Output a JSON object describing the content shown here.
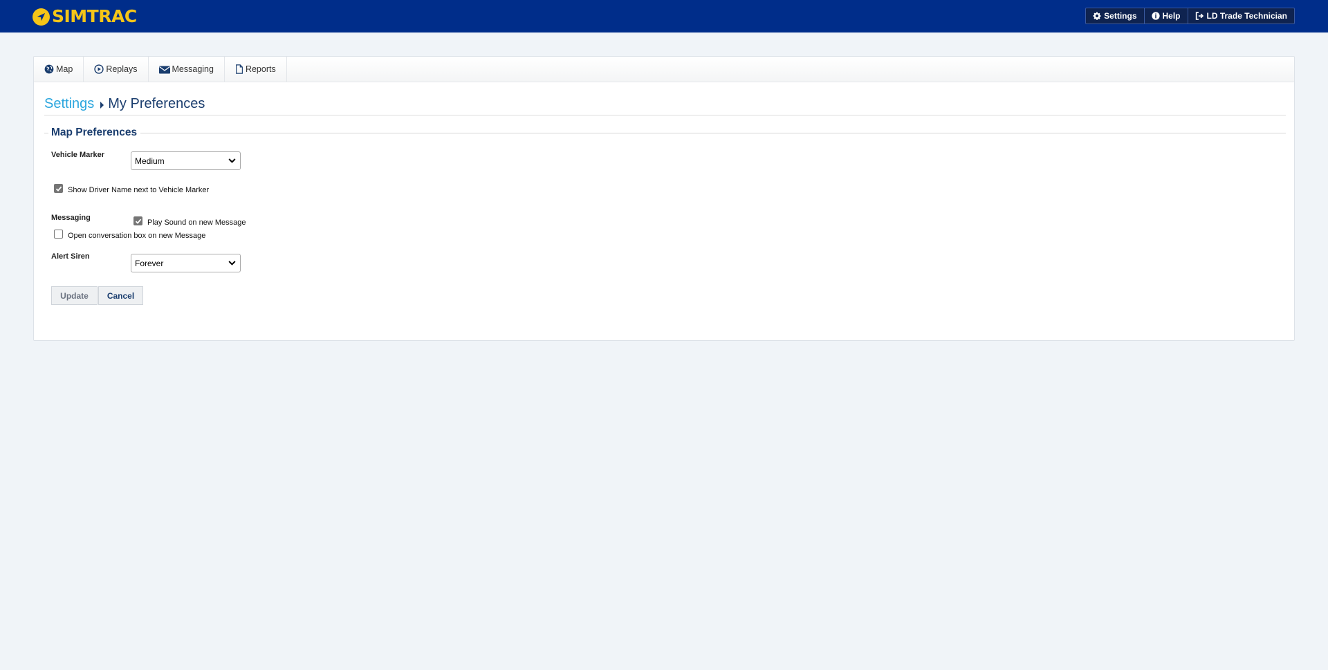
{
  "app": {
    "brand": "SIMTRAC",
    "colors": {
      "header_bg": "#002d8a",
      "brand_yellow": "#f5c518",
      "link": "#2ba6de",
      "heading": "#1a3d6e"
    }
  },
  "header": {
    "actions": [
      {
        "label": "Settings",
        "icon": "gear-icon"
      },
      {
        "label": "Help",
        "icon": "info-icon"
      },
      {
        "label": "LD Trade Technician",
        "icon": "sign-out-icon"
      }
    ]
  },
  "tabs": [
    {
      "label": "Map",
      "icon": "globe-icon"
    },
    {
      "label": "Replays",
      "icon": "play-circle-icon"
    },
    {
      "label": "Messaging",
      "icon": "envelope-icon"
    },
    {
      "label": "Reports",
      "icon": "file-icon"
    }
  ],
  "breadcrumb": {
    "parent": "Settings",
    "current": "My Preferences"
  },
  "map_preferences": {
    "legend": "Map Preferences",
    "vehicle_marker": {
      "label": "Vehicle Marker",
      "value": "Medium"
    },
    "show_driver_name": {
      "label": "Show Driver Name next to Vehicle Marker",
      "checked": true
    },
    "messaging": {
      "label": "Messaging",
      "play_sound": {
        "label": "Play Sound on new Message",
        "checked": true
      },
      "open_conversation": {
        "label": "Open conversation box on new Message",
        "checked": false
      }
    },
    "alert_siren": {
      "label": "Alert Siren",
      "value": "Forever"
    }
  },
  "actions": {
    "update": "Update",
    "cancel": "Cancel"
  }
}
